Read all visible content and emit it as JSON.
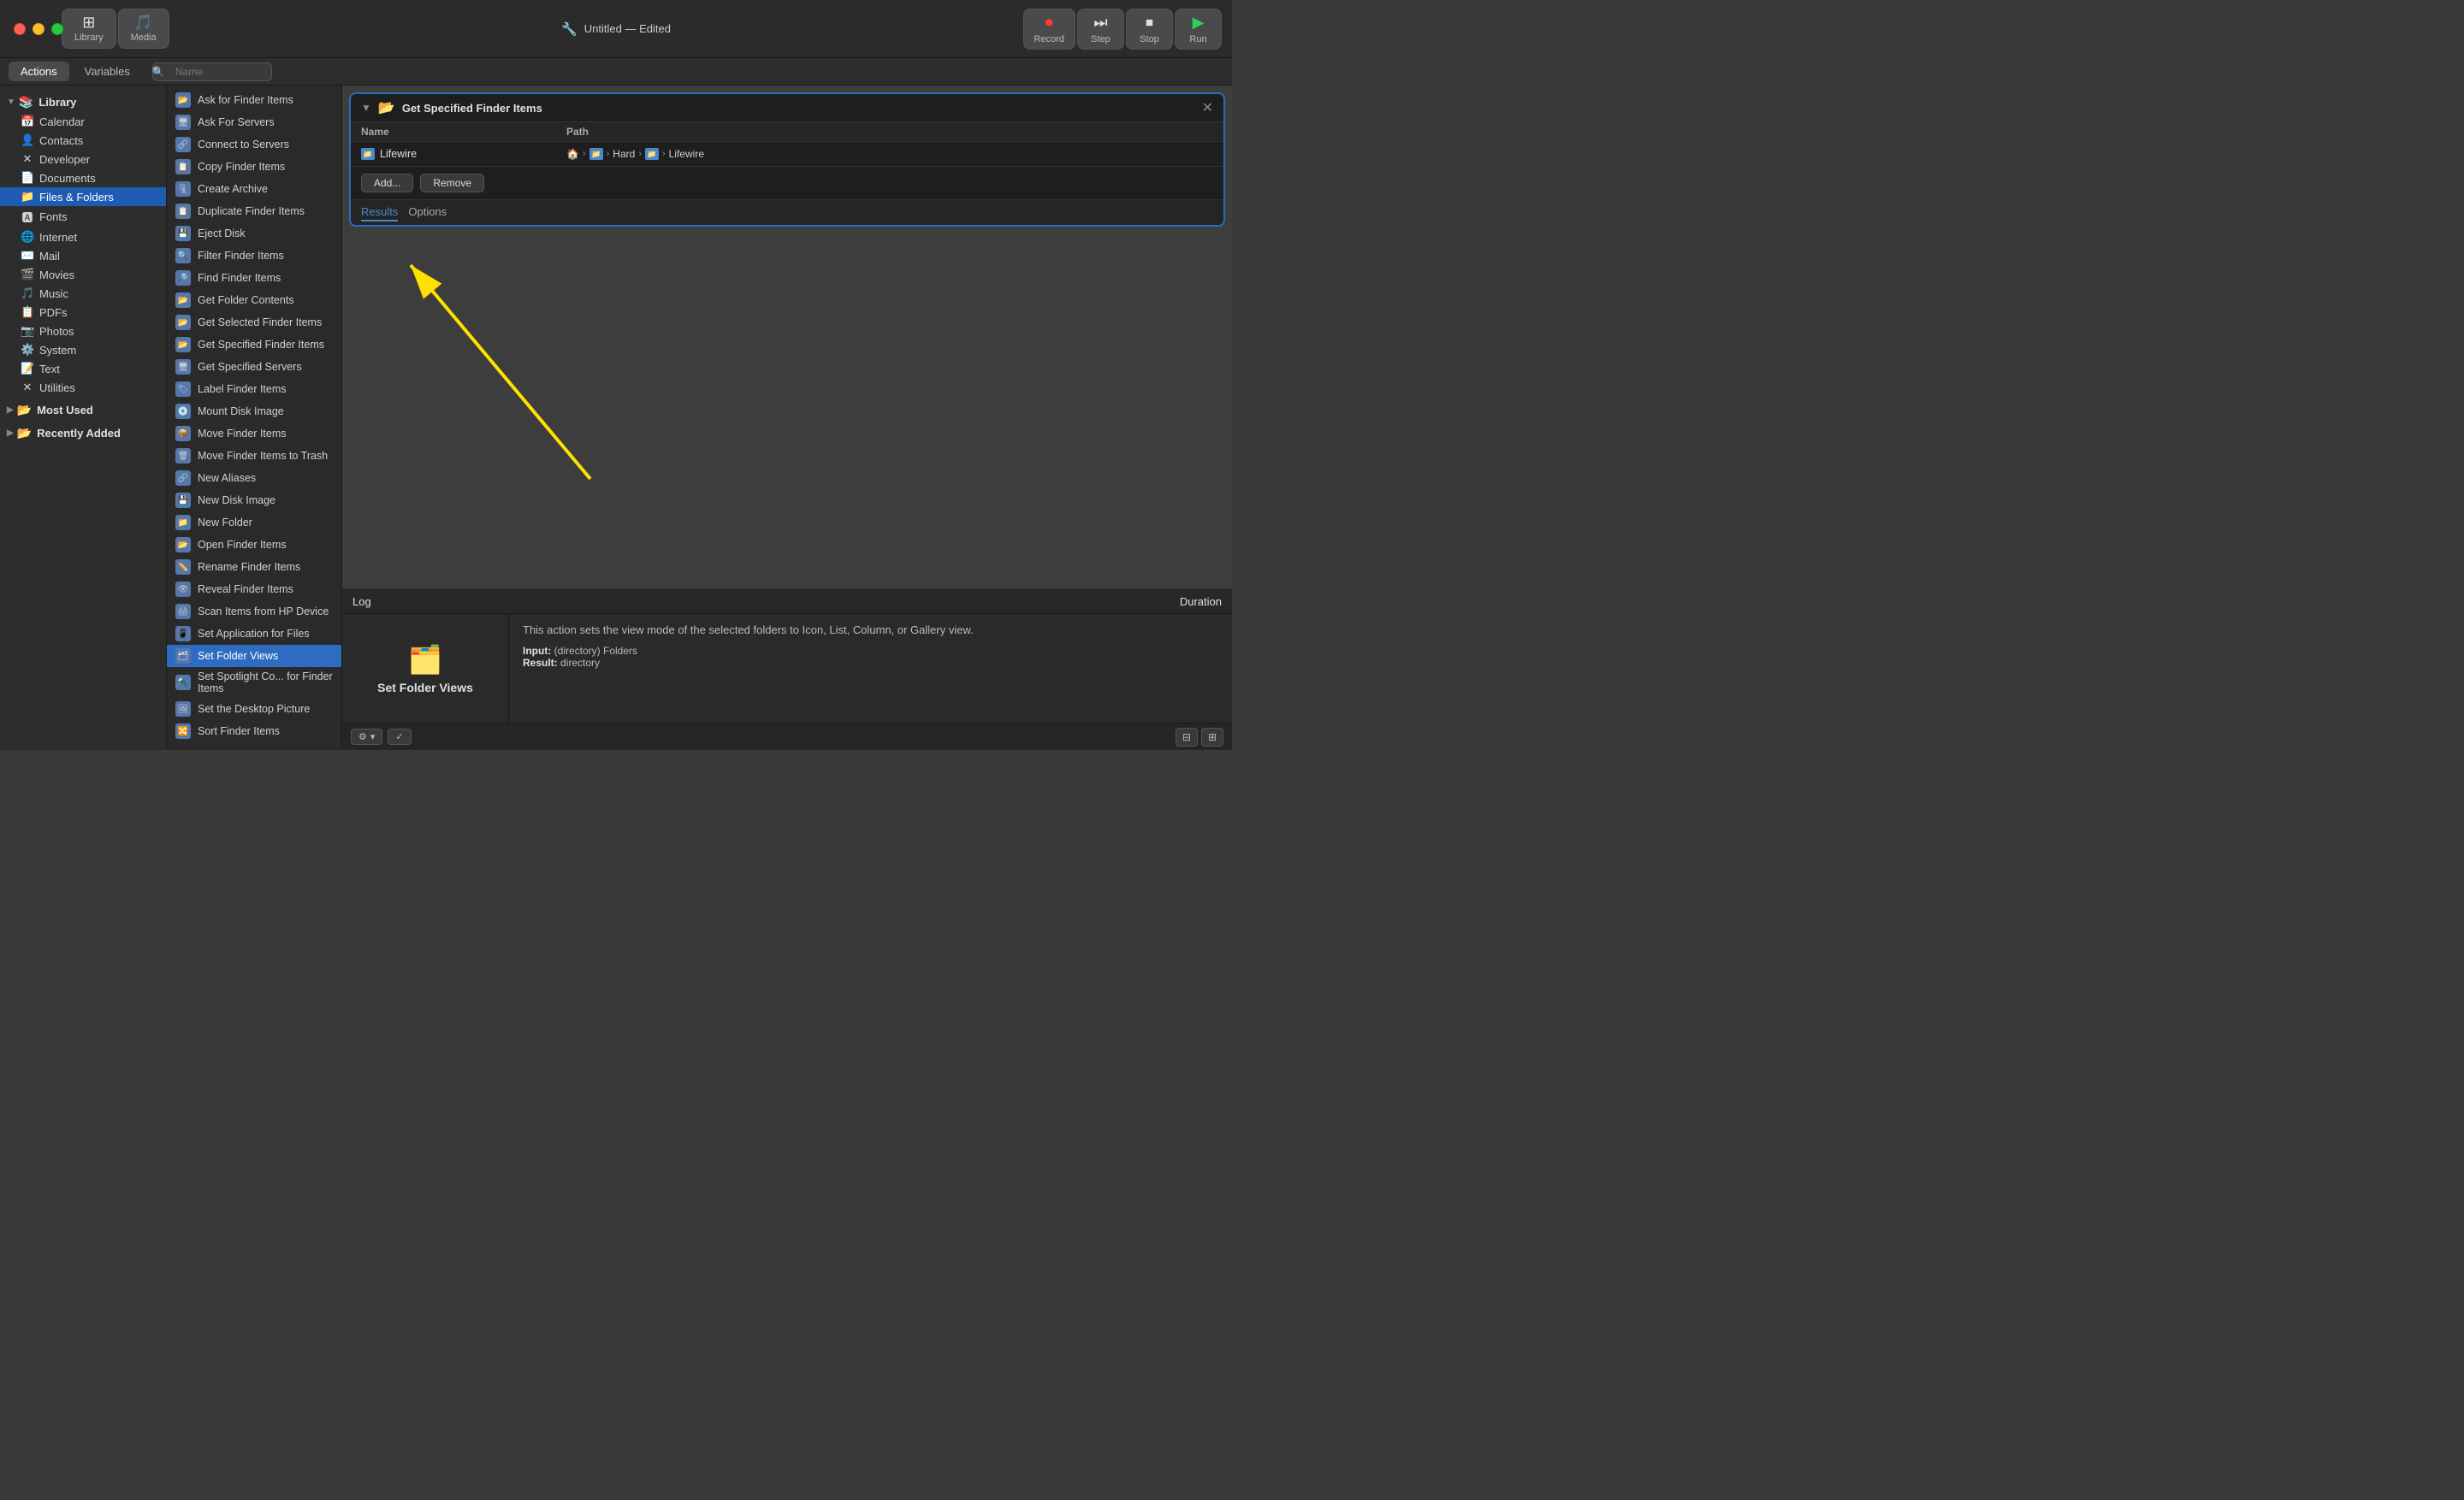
{
  "titleBar": {
    "title": "Untitled",
    "subtitle": "Edited",
    "icon": "🔧"
  },
  "toolbar": {
    "library_label": "Library",
    "media_label": "Media",
    "record_label": "Record",
    "step_label": "Step",
    "stop_label": "Stop",
    "run_label": "Run"
  },
  "tabs": {
    "actions_label": "Actions",
    "variables_label": "Variables",
    "search_placeholder": "Name"
  },
  "sidebar": {
    "items": [
      {
        "id": "library",
        "label": "Library",
        "type": "group",
        "expanded": true
      },
      {
        "id": "calendar",
        "label": "Calendar",
        "icon": "📅"
      },
      {
        "id": "contacts",
        "label": "Contacts",
        "icon": "👤"
      },
      {
        "id": "developer",
        "label": "Developer",
        "icon": "✕"
      },
      {
        "id": "documents",
        "label": "Documents",
        "icon": "📄"
      },
      {
        "id": "files-folders",
        "label": "Files & Folders",
        "icon": "📁",
        "active": true
      },
      {
        "id": "fonts",
        "label": "Fonts",
        "icon": "🅰"
      },
      {
        "id": "internet",
        "label": "Internet",
        "icon": "🌐"
      },
      {
        "id": "mail",
        "label": "Mail",
        "icon": "✉️"
      },
      {
        "id": "movies",
        "label": "Movies",
        "icon": "🎬"
      },
      {
        "id": "music",
        "label": "Music",
        "icon": "🎵"
      },
      {
        "id": "pdfs",
        "label": "PDFs",
        "icon": "📋"
      },
      {
        "id": "photos",
        "label": "Photos",
        "icon": "📷"
      },
      {
        "id": "system",
        "label": "System",
        "icon": "⚙️"
      },
      {
        "id": "text",
        "label": "Text",
        "icon": "📝"
      },
      {
        "id": "utilities",
        "label": "Utilities",
        "icon": "✕"
      },
      {
        "id": "most-used",
        "label": "Most Used",
        "type": "group"
      },
      {
        "id": "recently-added",
        "label": "Recently Added",
        "type": "group"
      }
    ]
  },
  "actionList": {
    "items": [
      {
        "id": "ask-finder",
        "label": "Ask for Finder Items"
      },
      {
        "id": "ask-servers",
        "label": "Ask For Servers"
      },
      {
        "id": "connect-servers",
        "label": "Connect to Servers"
      },
      {
        "id": "copy-finder",
        "label": "Copy Finder Items"
      },
      {
        "id": "create-archive",
        "label": "Create Archive"
      },
      {
        "id": "duplicate-finder",
        "label": "Duplicate Finder Items"
      },
      {
        "id": "eject-disk",
        "label": "Eject Disk"
      },
      {
        "id": "filter-finder",
        "label": "Filter Finder Items"
      },
      {
        "id": "find-finder",
        "label": "Find Finder Items"
      },
      {
        "id": "get-folder-contents",
        "label": "Get Folder Contents"
      },
      {
        "id": "get-selected-finder",
        "label": "Get Selected Finder Items"
      },
      {
        "id": "get-specified-finder",
        "label": "Get Specified Finder Items"
      },
      {
        "id": "get-specified-servers",
        "label": "Get Specified Servers"
      },
      {
        "id": "label-finder",
        "label": "Label Finder Items"
      },
      {
        "id": "mount-disk",
        "label": "Mount Disk Image"
      },
      {
        "id": "move-finder",
        "label": "Move Finder Items"
      },
      {
        "id": "move-finder-trash",
        "label": "Move Finder Items to Trash"
      },
      {
        "id": "new-aliases",
        "label": "New Aliases"
      },
      {
        "id": "new-disk-image",
        "label": "New Disk Image"
      },
      {
        "id": "new-folder",
        "label": "New Folder"
      },
      {
        "id": "open-finder-items",
        "label": "Open Finder Items"
      },
      {
        "id": "rename-finder",
        "label": "Rename Finder Items"
      },
      {
        "id": "reveal-finder",
        "label": "Reveal Finder Items"
      },
      {
        "id": "scan-items-hp",
        "label": "Scan Items from HP Device"
      },
      {
        "id": "set-application",
        "label": "Set Application for Files"
      },
      {
        "id": "set-folder-views",
        "label": "Set Folder Views",
        "selected": true
      },
      {
        "id": "set-spotlight",
        "label": "Set Spotlight Co... for Finder Items"
      },
      {
        "id": "set-desktop-picture",
        "label": "Set the Desktop Picture"
      },
      {
        "id": "sort-finder",
        "label": "Sort Finder Items"
      }
    ]
  },
  "actionBlock": {
    "title": "Get Specified Finder Items",
    "tableHeaders": {
      "name": "Name",
      "path": "Path"
    },
    "rows": [
      {
        "name": "Lifewire",
        "path_parts": [
          "🏠",
          "▶",
          "📁",
          "▶",
          "Hard",
          "▶",
          "📁",
          "▶",
          "Lifewire"
        ]
      }
    ],
    "addButton": "Add...",
    "removeButton": "Remove",
    "resultsTab": "Results",
    "optionsTab": "Options"
  },
  "logBar": {
    "log_label": "Log",
    "duration_label": "Duration"
  },
  "bottomPanel": {
    "icon": "🗂️",
    "title": "Set Folder Views",
    "description": "This action sets the view mode of the selected folders to Icon, List, Column, or Gallery view.",
    "input_label": "Input:",
    "input_value": "(directory) Folders",
    "result_label": "Result:",
    "result_value": "directory"
  },
  "bottomToolbar": {
    "gear_icon": "⚙",
    "check_icon": "✓",
    "view1_icon": "⊟",
    "view2_icon": "⊞"
  }
}
